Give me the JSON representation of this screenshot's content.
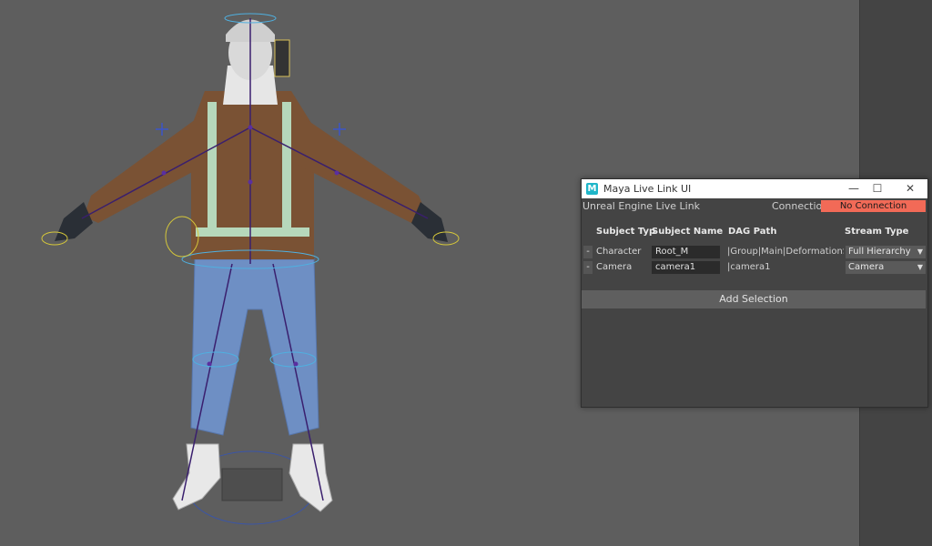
{
  "window": {
    "title": "Maya Live Link UI",
    "app_icon_letter": "M",
    "minimize": "—",
    "maximize": "☐",
    "close": "✕"
  },
  "header": {
    "label": "Unreal Engine Live Link",
    "connection_label": "Connection:",
    "connection_status": "No Connection",
    "connection_status_color": "#f26a57"
  },
  "table": {
    "columns": [
      "Subject Typ",
      "Subject Name",
      "DAG Path",
      "Stream Type"
    ],
    "rows": [
      {
        "remove": "-",
        "type": "Character",
        "name": "Root_M",
        "dag_path": "|Group|Main|DeformationSyst",
        "stream": "Full Hierarchy"
      },
      {
        "remove": "-",
        "type": "Camera",
        "name": "camera1",
        "dag_path": "|camera1",
        "stream": "Camera"
      }
    ]
  },
  "add_selection": "Add Selection",
  "colors": {
    "viewport_bg": "#5e5e5e",
    "panel_bg": "#444444",
    "jacket": "#7a5234",
    "pants": "#6e8fc4",
    "skeleton": "#3a1f6e"
  }
}
